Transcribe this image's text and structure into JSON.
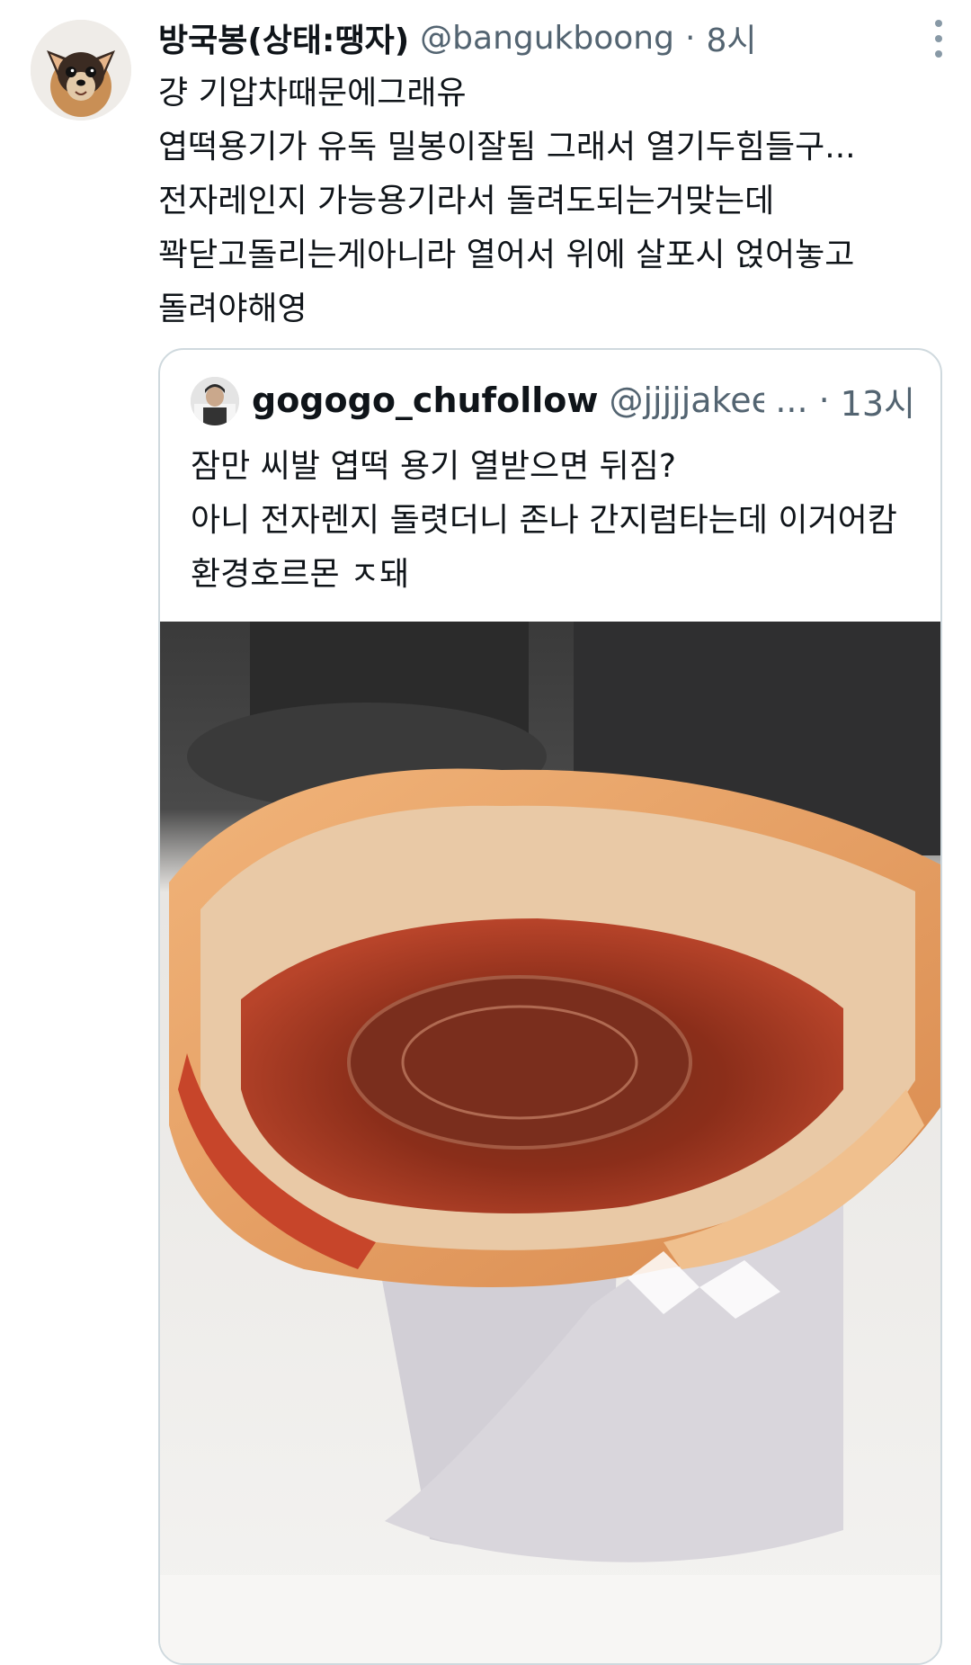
{
  "tweet": {
    "author": {
      "display_name": "방국봉(상태:땡자)",
      "handle": "@bangukboong",
      "separator": "·",
      "time": "8시",
      "avatar_icon": "chihuahua-avatar-icon"
    },
    "menu_icon": "more-options-icon",
    "body_lines": [
      "걍 기압차때문에그래유",
      "엽떡용기가 유독 밀봉이잘됨 그래서 열기두힘들구...",
      "전자레인지 가능용기라서 돌려도되는거맞는데",
      "꽉닫고돌리는게아니라 열어서 위에 살포시 얹어놓고",
      "돌려야해영"
    ]
  },
  "quote": {
    "author": {
      "display_name": "gogogo_chufollow",
      "handle": "@jjjjjakee",
      "ellipsis": "...",
      "separator": "·",
      "time": "13시",
      "avatar_icon": "profile-avatar-icon"
    },
    "body_lines": [
      "잠만 씨발 엽떡 용기 열받으면 뒤짐?",
      "아니 전자렌지 돌렷더니 존나 간지럼타는데 이거어캄",
      "환경호르몬 ㅈ돼"
    ],
    "media": {
      "description_icon": "warped-container-photo",
      "colors": {
        "counter": "#eeeeec",
        "sauce": "#8b2e1a",
        "rim": "#e8a66a",
        "container": "#d9d6dc"
      }
    }
  }
}
